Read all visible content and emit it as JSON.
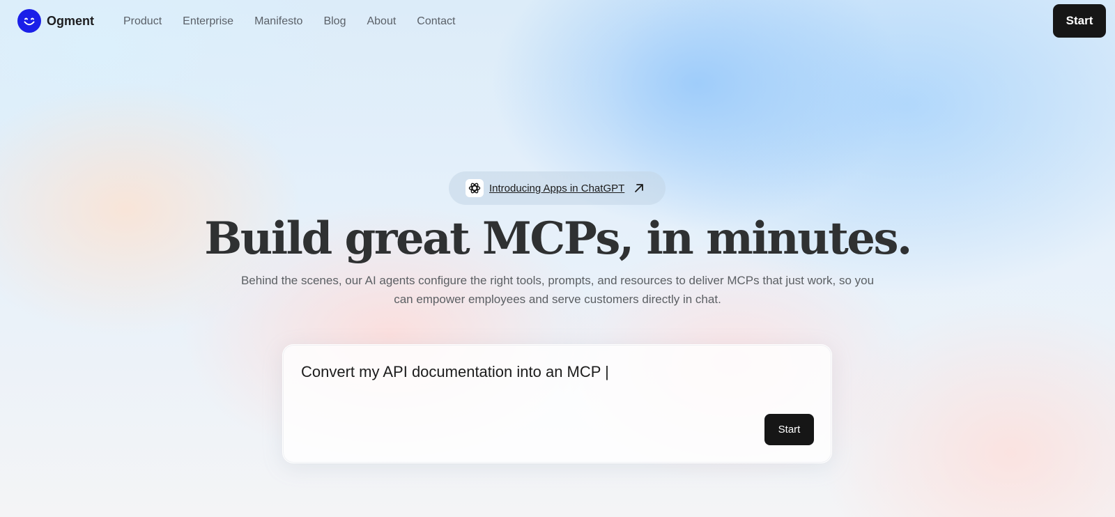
{
  "nav": {
    "logo_text": "Ogment",
    "links": [
      "Product",
      "Enterprise",
      "Manifesto",
      "Blog",
      "About",
      "Contact"
    ],
    "start_label": "Start"
  },
  "announcement": {
    "icon": "chatgpt-icon",
    "text": "Introducing Apps in ChatGPT",
    "arrow_icon": "arrow-up-right-icon"
  },
  "hero": {
    "headline": "Build great MCPs, in minutes.",
    "subtext": "Behind the scenes, our AI agents configure the right tools, prompts, and resources to deliver MCPs that just work, so you can empower employees and serve customers directly in chat."
  },
  "prompt": {
    "value": "Convert my API documentation into an MCP |",
    "start_label": "Start"
  },
  "colors": {
    "brand": "#1a1fe8",
    "button": "#161616",
    "headline": "#2f3132"
  }
}
